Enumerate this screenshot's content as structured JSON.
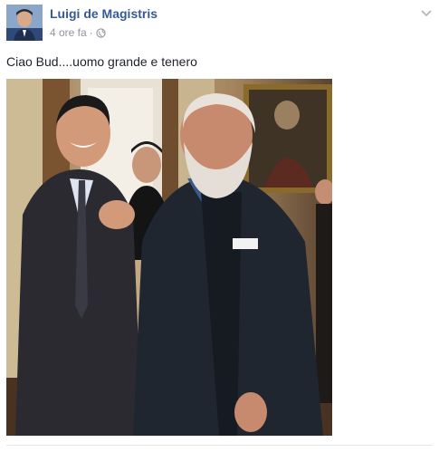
{
  "post": {
    "author": "Luigi de Magistris",
    "time": "4 ore fa",
    "separator": "·",
    "privacy_icon": "globe-icon",
    "menu_icon": "chevron-down-icon",
    "text": "Ciao Bud....uomo grande e tenero"
  },
  "colors": {
    "author_link": "#365899",
    "meta_text": "#90949c",
    "body_text": "#1d2129"
  }
}
